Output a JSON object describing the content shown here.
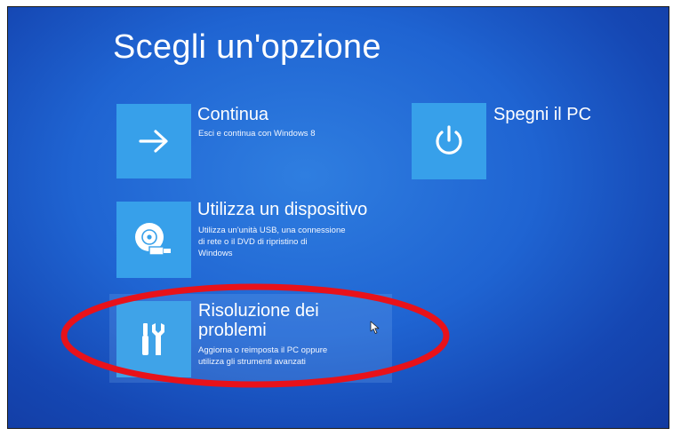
{
  "screen": {
    "title": "Scegli un'opzione"
  },
  "options": [
    {
      "title": "Continua",
      "description": "Esci e continua con Windows 8",
      "icon": "arrow-right-icon"
    },
    {
      "title": "Utilizza un dispositivo",
      "description": "Utilizza un'unità USB, una connessione\ndi rete o il DVD di ripristino di\nWindows",
      "icon": "disc-usb-icon"
    },
    {
      "title": "Risoluzione dei\nproblemi",
      "description": "Aggiorna o reimposta il PC oppure\nutilizza gli strumenti avanzati",
      "icon": "tools-icon",
      "highlighted": true
    },
    {
      "title": "Spegni il PC",
      "icon": "power-icon"
    }
  ],
  "annotation": {
    "shape": "ellipse",
    "color": "#e8121a",
    "target": "Risoluzione dei problemi"
  },
  "colors": {
    "background": "#1f64d2",
    "tile": "#37a0ea",
    "text": "#ffffff"
  }
}
